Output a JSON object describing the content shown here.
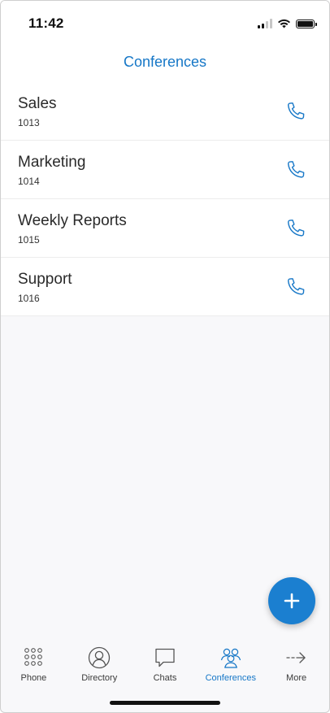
{
  "status_bar": {
    "time": "11:42",
    "icons": [
      "signal-icon",
      "wifi-icon",
      "battery-icon"
    ]
  },
  "header": {
    "title": "Conferences"
  },
  "conferences": [
    {
      "name": "Sales",
      "extension": "1013"
    },
    {
      "name": "Marketing",
      "extension": "1014"
    },
    {
      "name": "Weekly Reports",
      "extension": "1015"
    },
    {
      "name": "Support",
      "extension": "1016"
    }
  ],
  "fab": {
    "icon": "plus-icon"
  },
  "tab_bar": {
    "tabs": [
      {
        "label": "Phone",
        "icon": "keypad-icon",
        "active": false
      },
      {
        "label": "Directory",
        "icon": "person-icon",
        "active": false
      },
      {
        "label": "Chats",
        "icon": "chat-bubble-icon",
        "active": false
      },
      {
        "label": "Conferences",
        "icon": "group-icon",
        "active": true
      },
      {
        "label": "More",
        "icon": "arrow-right-icon",
        "active": false
      }
    ]
  },
  "colors": {
    "accent": "#1677c7",
    "fab": "#1b7fd0",
    "text": "#2a2a2a",
    "divider": "#ececec"
  }
}
